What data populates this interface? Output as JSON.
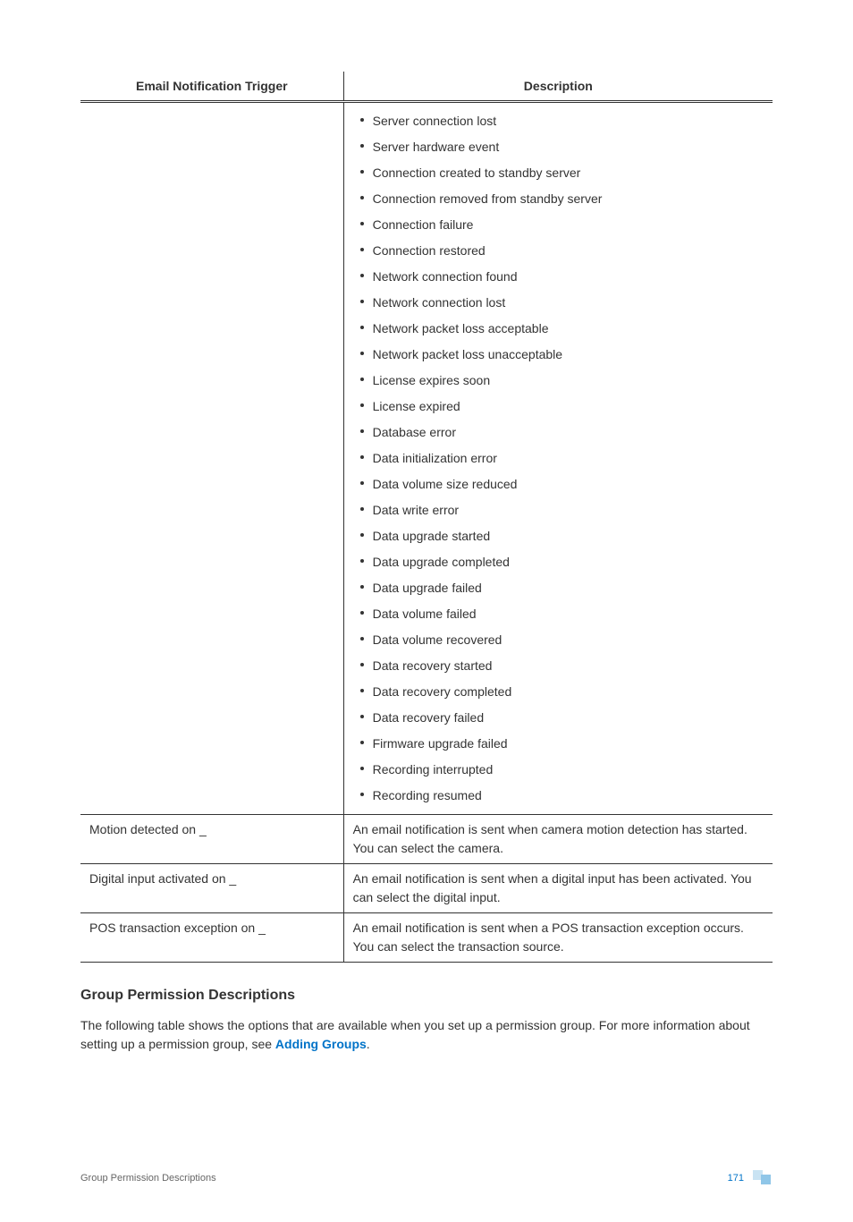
{
  "table": {
    "headers": {
      "col1": "Email Notification Trigger",
      "col2": "Description"
    },
    "rows": [
      {
        "trigger": "",
        "list": [
          "Server connection lost",
          "Server hardware event",
          "Connection created to standby server",
          "Connection removed from standby server",
          "Connection failure",
          "Connection restored",
          "Network connection found",
          "Network connection lost",
          "Network packet loss acceptable",
          "Network packet loss unacceptable",
          "License expires soon",
          "License expired",
          "Database error",
          "Data initialization error",
          "Data volume size reduced",
          "Data write error",
          "Data upgrade started",
          "Data upgrade completed",
          "Data upgrade failed",
          "Data volume failed",
          "Data volume recovered",
          "Data recovery started",
          "Data recovery completed",
          "Data recovery failed",
          "Firmware upgrade failed",
          "Recording interrupted",
          "Recording resumed"
        ]
      },
      {
        "trigger": "Motion detected on _",
        "desc": "An email notification is sent when camera motion detection has started. You can select the camera."
      },
      {
        "trigger": "Digital input activated on _",
        "desc": "An email notification is sent when a digital input has been activated. You can select the digital input."
      },
      {
        "trigger": "POS transaction exception on _",
        "desc": "An email notification is sent when a POS transaction exception occurs. You can select the transaction source."
      }
    ]
  },
  "section_heading": "Group Permission Descriptions",
  "section_body_pre": "The following table shows the options that are available when you set up a permission group. For more information about setting up a permission group, see ",
  "section_link": "Adding Groups",
  "section_body_post": ".",
  "footer_title": "Group Permission Descriptions",
  "page_number": "171"
}
